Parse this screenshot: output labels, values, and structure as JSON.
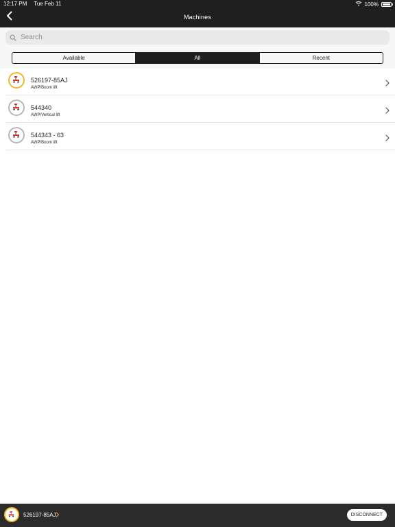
{
  "status_bar": {
    "time": "12:17 PM",
    "date": "Tue Feb 11",
    "battery": "100%"
  },
  "header": {
    "title": "Machines",
    "back_icon": "chevron-left-icon"
  },
  "search": {
    "placeholder": "Search"
  },
  "segments": {
    "items": [
      "Available",
      "All",
      "Recent"
    ],
    "selected": "All"
  },
  "machines": [
    {
      "id": "526197-85AJ",
      "type": "AWP/Boom lift",
      "icon": "machine-icon"
    },
    {
      "id": "544340",
      "type": "AWP/Vertical lift",
      "icon": "machine-icon"
    },
    {
      "id": "544343 - 63",
      "type": "AWP/Boom lift",
      "icon": "machine-icon"
    }
  ],
  "bottom_bar": {
    "connected_machine": "526197-85AJ",
    "disconnect_label": "DISCONNECT"
  },
  "colors": {
    "accent": "#f2b82b",
    "header_bg": "#1f1f1f",
    "bottom_bg": "#2b2b2b"
  }
}
